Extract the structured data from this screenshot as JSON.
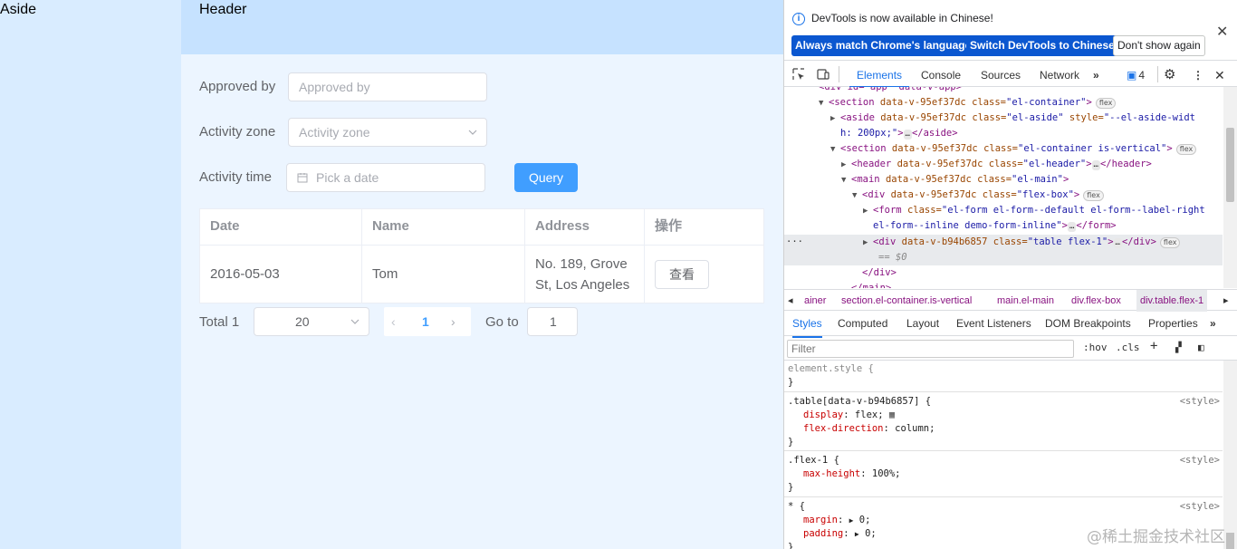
{
  "app": {
    "aside": "Aside",
    "header": "Header",
    "form": {
      "approved_by_label": "Approved by",
      "approved_by_placeholder": "Approved by",
      "activity_zone_label": "Activity zone",
      "activity_zone_placeholder": "Activity zone",
      "activity_time_label": "Activity time",
      "activity_time_placeholder": "Pick a date",
      "query_button": "Query"
    },
    "table": {
      "headers": [
        "Date",
        "Name",
        "Address",
        "操作"
      ],
      "rows": [
        {
          "date": "2016-05-03",
          "name": "Tom",
          "address": "No. 189, Grove St, Los Angeles",
          "action": "查看"
        }
      ]
    },
    "pagination": {
      "total": "Total 1",
      "page_size": "20",
      "current_page": "1",
      "goto_label": "Go to",
      "goto_value": "1"
    }
  },
  "devtools": {
    "notification": {
      "text": "DevTools is now available in Chinese!",
      "btn_match": "Always match Chrome's language",
      "btn_switch": "Switch DevTools to Chinese",
      "btn_dismiss": "Don't show again"
    },
    "tabs": [
      "Elements",
      "Console",
      "Sources",
      "Network"
    ],
    "issues_count": "4",
    "dom_lines": {
      "l0": "<div id=\"app\" data-v-app>",
      "l1_tag": "section",
      "l1_attr": "data-v-95ef37dc class=",
      "l1_val": "\"el-container\"",
      "l2_tag": "aside",
      "l2_attr": "data-v-95ef37dc class=",
      "l2_val": "\"el-aside\"",
      "l2_attr2": " style=",
      "l2_val2": "\"--el-aside-widt",
      "l3_val": "h: 200px;\"",
      "l3_end": "</aside>",
      "l4_tag": "section",
      "l4_attr": "data-v-95ef37dc class=",
      "l4_val": "\"el-container is-vertical\"",
      "l5_tag": "header",
      "l5_attr": "data-v-95ef37dc class=",
      "l5_val": "\"el-header\"",
      "l5_end": "</header>",
      "l6_tag": "main",
      "l6_attr": "data-v-95ef37dc class=",
      "l6_val": "\"el-main\"",
      "l7_tag": "div",
      "l7_attr": "data-v-95ef37dc class=",
      "l7_val": "\"flex-box\"",
      "l8_tag": "form",
      "l8_attr": "class=",
      "l8_val": "\"el-form el-form--default el-form--label-right",
      "l9_val": "el-form--inline demo-form-inline\"",
      "l9_end": "</form>",
      "l10_tag": "div",
      "l10_attr": "data-v-b94b6857 class=",
      "l10_val": "\"table flex-1\"",
      "l10_end": "</div>",
      "l11": "== $0",
      "l12": "</div>",
      "l13": "</main>",
      "flex_badge": "flex",
      "ellipsis": "…"
    },
    "breadcrumbs": [
      "ainer",
      "section.el-container.is-vertical",
      "main.el-main",
      "div.flex-box",
      "div.table.flex-1"
    ],
    "subtabs": [
      "Styles",
      "Computed",
      "Layout",
      "Event Listeners",
      "DOM Breakpoints",
      "Properties"
    ],
    "filter_placeholder": "Filter",
    "hov": ":hov",
    "cls": ".cls",
    "styles": {
      "r0_sel": "element.style {",
      "close": "}",
      "r1_sel": ".table[data-v-b94b6857] {",
      "r1_src": "<style>",
      "r1_p1n": "display",
      "r1_p1v": "flex;",
      "r1_p2n": "flex-direction",
      "r1_p2v": "column;",
      "r2_sel": ".flex-1 {",
      "r2_src": "<style>",
      "r2_p1n": "max-height",
      "r2_p1v": "100%;",
      "r3_sel": "* {",
      "r3_src": "<style>",
      "r3_p1n": "margin",
      "r3_p1v": "0;",
      "r3_p2n": "padding",
      "r3_p2v": "0;"
    }
  },
  "watermark": "@稀土掘金技术社区"
}
